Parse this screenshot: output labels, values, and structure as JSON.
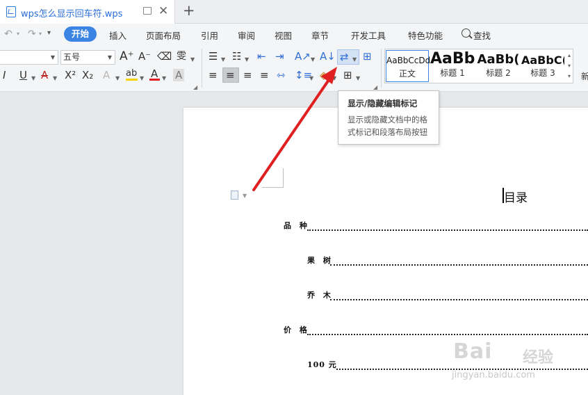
{
  "window": {
    "doc_title": "wps怎么显示回车符.wps",
    "new_tab_glyph": "+",
    "close_glyph": "✕"
  },
  "menu": {
    "active": "开始",
    "items": [
      "插入",
      "页面布局",
      "引用",
      "审阅",
      "视图",
      "章节",
      "开发工具",
      "特色功能"
    ],
    "search_label": "查找"
  },
  "ribbon": {
    "font_size": "五号",
    "pinyin_glyph": "雯",
    "styles_label_new": "新",
    "styles": [
      {
        "sample": "AaBbCcDd",
        "label": "正文"
      },
      {
        "sample": "AaBb",
        "label": "标题 1"
      },
      {
        "sample": "AaBb(",
        "label": "标题 2"
      },
      {
        "sample": "AaBbC(",
        "label": "标题 3"
      }
    ]
  },
  "tooltip": {
    "title": "显示/隐藏编辑标记",
    "description": "显示或隐藏文档中的格式标记和段落布局按钮"
  },
  "document": {
    "heading": "目录",
    "toc": [
      {
        "text": "品 种"
      },
      {
        "text": "果 树"
      },
      {
        "text": "乔 木"
      },
      {
        "text": "价 格"
      },
      {
        "text": "100 元"
      }
    ]
  },
  "watermark": {
    "brand": "Bai",
    "brand_suffix": "经验",
    "url": "jingyan.baidu.com"
  },
  "colors": {
    "accent": "#3b84e4",
    "arrow": "#e02020",
    "highlight": "#f5d20a",
    "font_color_bar": "#e02020"
  },
  "icons": {
    "undo": "undo-icon",
    "redo": "redo-icon",
    "search": "search-icon",
    "show_hide_marks": "show-hide-marks-icon"
  }
}
